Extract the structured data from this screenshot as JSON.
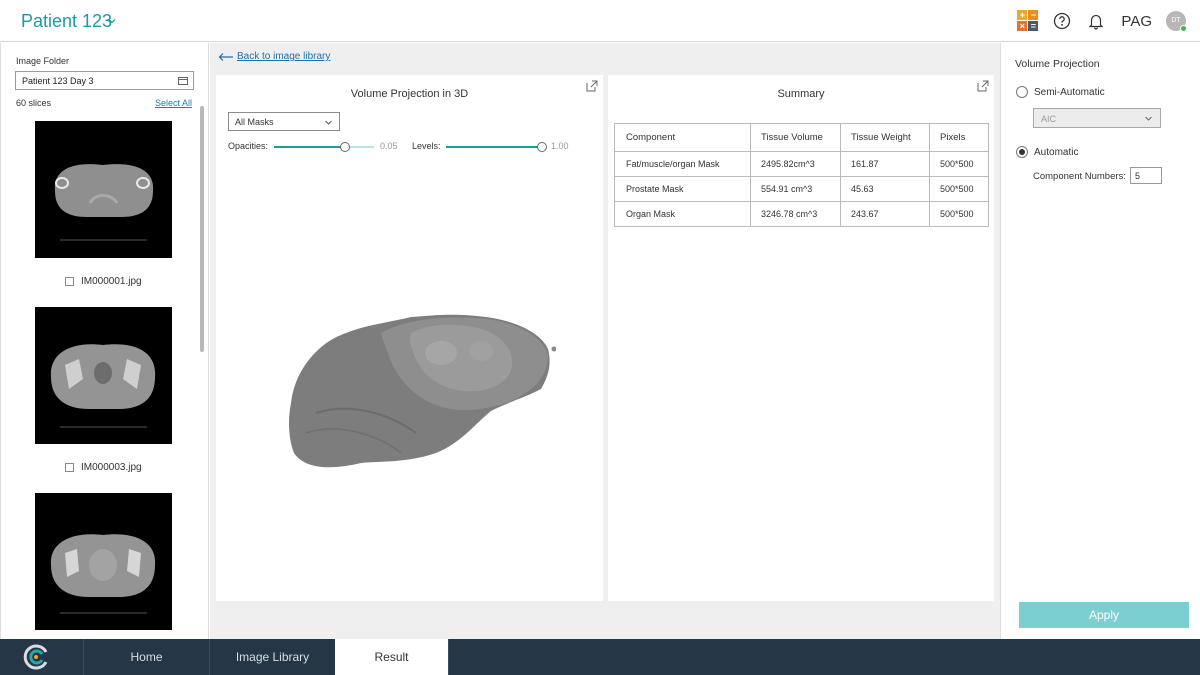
{
  "header": {
    "patient_title": "Patient 123",
    "user_code": "PAG",
    "avatar_initials": "DT",
    "icons": [
      "calculator-icon",
      "help-icon",
      "bell-icon"
    ]
  },
  "left": {
    "folder_label": "Image Folder",
    "folder_value": "Patient 123 Day 3",
    "slice_count": "60 slices",
    "select_all": "Select All",
    "images": [
      {
        "name": "IM000001.jpg",
        "checked": false
      },
      {
        "name": "IM000003.jpg",
        "checked": false
      },
      {
        "name": "",
        "checked": false
      }
    ]
  },
  "center": {
    "back_link": "Back to image library",
    "volume_panel": {
      "title": "Volume Projection in 3D",
      "mask_select": "All Masks",
      "opacity_label": "Opacities:",
      "opacity_value": "0.05",
      "levels_label": "Levels:",
      "levels_value": "1.00"
    },
    "summary_panel": {
      "title": "Summary",
      "columns": [
        "Component",
        "Tissue Volume",
        "Tissue Weight",
        "Pixels"
      ],
      "rows": [
        [
          "Fat/muscle/organ Mask",
          "2495.82cm^3",
          "161.87",
          "500*500"
        ],
        [
          "Prostate Mask",
          "554.91 cm^3",
          "45.63",
          "500*500"
        ],
        [
          "Organ Mask",
          "3246.78 cm^3",
          "243.67",
          "500*500"
        ]
      ]
    }
  },
  "right": {
    "title": "Volume Projection",
    "semi_auto_label": "Semi-Automatic",
    "aic_value": "AIC",
    "auto_label": "Automatic",
    "selected_mode": "Automatic",
    "component_label": "Component Numbers:",
    "component_value": "5",
    "apply_label": "Apply"
  },
  "nav": {
    "tabs": [
      "Home",
      "Image Library",
      "Result"
    ],
    "active": "Result"
  },
  "colors": {
    "accent": "#1f9aa0",
    "nav_bg": "#253746",
    "apply_bg": "#7ccfd0",
    "link": "#1f6fa8"
  }
}
